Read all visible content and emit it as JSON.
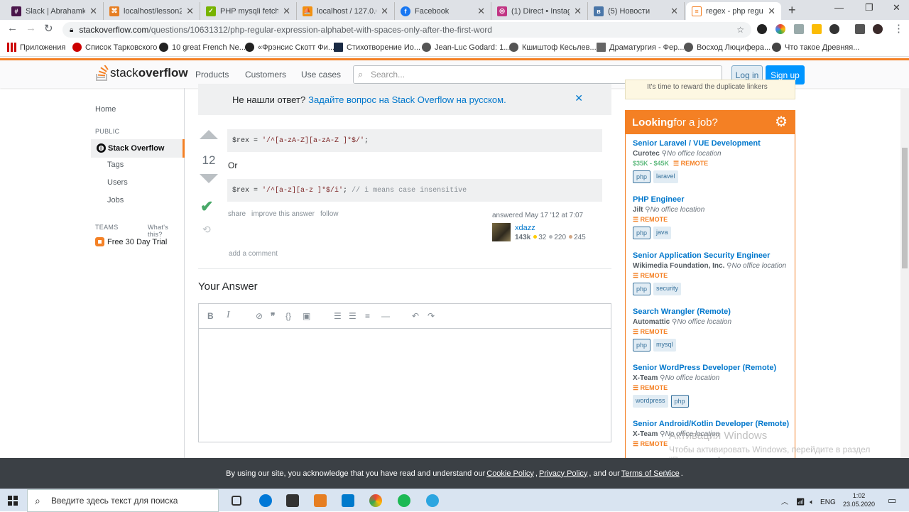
{
  "tabs": [
    {
      "title": "Slack | Abrahamkare",
      "color": "#4a154b"
    },
    {
      "title": "localhost/lesson2/ca",
      "color": "#e67e22"
    },
    {
      "title": "PHP mysqli fetch_all",
      "color": "#77b300"
    },
    {
      "title": "localhost / 127.0.0.1",
      "color": "#f29111"
    },
    {
      "title": "Facebook",
      "color": "#1877f2"
    },
    {
      "title": "(1) Direct • Instagram",
      "color": "#c13584"
    },
    {
      "title": "(5) Новости",
      "color": "#4a76a8"
    },
    {
      "title": "regex - php regular",
      "color": "#f48024"
    }
  ],
  "address": {
    "host": "stackoverflow.com",
    "path": "/questions/10631312/php-regular-expression-alphabet-with-spaces-only-after-the-first-word"
  },
  "bookmarks": [
    "Приложения",
    "Список Тарковского",
    "10 great French Ne...",
    "«Фрэнсис Скотт Фи...",
    "Стихотворение Ио...",
    "Jean-Luc Godard: 1...",
    "Кшиштоф Кесьлев...",
    "Драматургия - Фер...",
    "Восход Люцифера...",
    "Что такое Древняя..."
  ],
  "so": {
    "logo_a": "stack",
    "logo_b": "overflow",
    "nav": [
      "Products",
      "Customers",
      "Use cases"
    ],
    "search_placeholder": "Search...",
    "login": "Log in",
    "signup": "Sign up"
  },
  "leftnav": {
    "home": "Home",
    "public": "PUBLIC",
    "stackoverflow": "Stack Overflow",
    "tags": "Tags",
    "users": "Users",
    "jobs": "Jobs",
    "teams": "TEAMS",
    "whats": "What's this?",
    "trial": "Free 30 Day Trial"
  },
  "banner": {
    "text": "Не нашли ответ?",
    "link": "Задайте вопрос на Stack Overflow на русском."
  },
  "answer": {
    "votes": "12",
    "code1_a": "$rex = ",
    "code1_s": "'/^[a-zA-Z][a-zA-Z ]*$/'",
    "code1_b": ";",
    "or": "Or",
    "code2_a": "$rex = ",
    "code2_s": "'/^[a-z][a-z ]*$/i'",
    "code2_b": "; ",
    "code2_c": "// i means case insensitive",
    "share": "share",
    "improve": "improve this answer",
    "follow": "follow",
    "answered": "answered May 17 '12 at 7:07",
    "user": "xdazz",
    "rep": "143k",
    "gold": "32",
    "silver": "220",
    "bronze": "245",
    "addcomment": "add a comment"
  },
  "your_answer": "Your Answer",
  "sidebar_top": "It's time to reward the duplicate linkers",
  "jobs": {
    "head_a": "Looking",
    "head_b": " for a job?",
    "items": [
      {
        "title": "Senior Laravel / VUE Development",
        "company": "Curotec",
        "loc": "No office location",
        "salary": "$35K - $45K",
        "remote": "REMOTE",
        "tags": [
          "php",
          "laravel"
        ]
      },
      {
        "title": "PHP Engineer",
        "company": "Jilt",
        "loc": "No office location",
        "salary": "",
        "remote": "REMOTE",
        "tags": [
          "php",
          "java"
        ]
      },
      {
        "title": "Senior Application Security Engineer",
        "company": "Wikimedia Foundation, Inc.",
        "loc": "No office location",
        "salary": "",
        "remote": "REMOTE",
        "tags": [
          "php",
          "security"
        ]
      },
      {
        "title": "Search Wrangler (Remote)",
        "company": "Automattic",
        "loc": "No office location",
        "salary": "",
        "remote": "REMOTE",
        "tags": [
          "php",
          "mysql"
        ]
      },
      {
        "title": "Senior WordPress Developer (Remote)",
        "company": "X-Team",
        "loc": "No office location",
        "salary": "",
        "remote": "REMOTE",
        "tags": [
          "wordpress",
          "php"
        ]
      },
      {
        "title": "Senior Android/Kotlin Developer (Remote)",
        "company": "X-Team",
        "loc": "No office location",
        "salary": "",
        "remote": "REMOTE",
        "tags": []
      }
    ]
  },
  "cookie": {
    "a": "By using our site, you acknowledge that you have read and understand our ",
    "cp": "Cookie Policy",
    "b": ", ",
    "pp": "Privacy Policy",
    "c": ", and our ",
    "tos": "Terms of Service",
    "d": "."
  },
  "watermark": {
    "title": "Активация Windows",
    "text": "Чтобы активировать Windows, перейдите в раздел \"Параметры\"."
  },
  "taskbar": {
    "search": "Введите здесь текст для поиска",
    "lang": "ENG",
    "time": "1:02",
    "date": "23.05.2020"
  }
}
